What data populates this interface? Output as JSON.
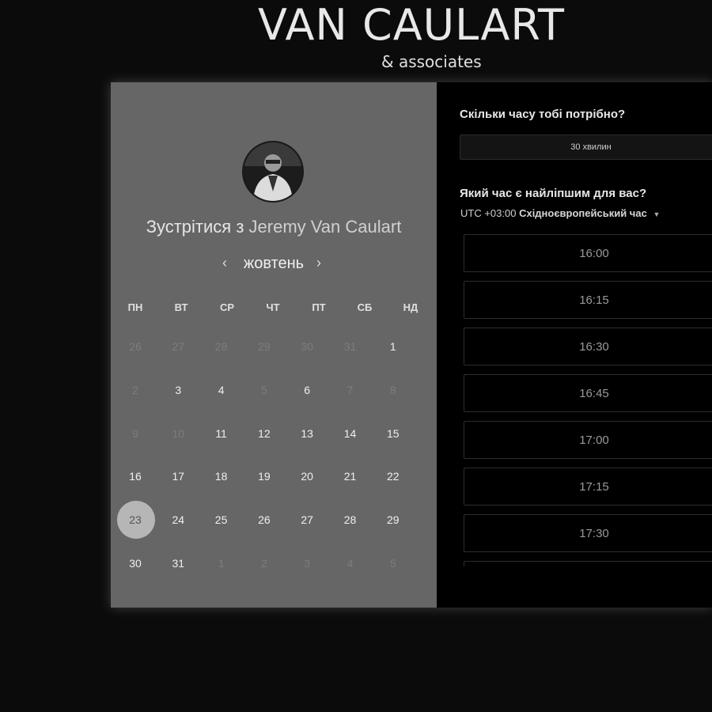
{
  "brand": {
    "name": "VAN CAULART",
    "sub": "& associates"
  },
  "left": {
    "meet_prefix": "Зустрітися з",
    "host": "Jeremy Van Caulart",
    "month": "жовтень",
    "prev_icon": "‹",
    "next_icon": "›",
    "weekdays": [
      "ПН",
      "ВТ",
      "СР",
      "ЧТ",
      "ПТ",
      "СБ",
      "НД"
    ],
    "days": [
      {
        "d": "26",
        "m": 1
      },
      {
        "d": "27",
        "m": 1
      },
      {
        "d": "28",
        "m": 1
      },
      {
        "d": "29",
        "m": 1
      },
      {
        "d": "30",
        "m": 1
      },
      {
        "d": "31",
        "m": 1
      },
      {
        "d": "1",
        "m": 0
      },
      {
        "d": "2",
        "m": 1
      },
      {
        "d": "3",
        "m": 0
      },
      {
        "d": "4",
        "m": 0
      },
      {
        "d": "5",
        "m": 1
      },
      {
        "d": "6",
        "m": 0
      },
      {
        "d": "7",
        "m": 1
      },
      {
        "d": "8",
        "m": 1
      },
      {
        "d": "9",
        "m": 1
      },
      {
        "d": "10",
        "m": 1
      },
      {
        "d": "11",
        "m": 0
      },
      {
        "d": "12",
        "m": 0
      },
      {
        "d": "13",
        "m": 0
      },
      {
        "d": "14",
        "m": 0
      },
      {
        "d": "15",
        "m": 0
      },
      {
        "d": "16",
        "m": 0
      },
      {
        "d": "17",
        "m": 0
      },
      {
        "d": "18",
        "m": 0
      },
      {
        "d": "19",
        "m": 0
      },
      {
        "d": "20",
        "m": 0
      },
      {
        "d": "21",
        "m": 0
      },
      {
        "d": "22",
        "m": 0
      },
      {
        "d": "23",
        "m": 0,
        "sel": 1
      },
      {
        "d": "24",
        "m": 0
      },
      {
        "d": "25",
        "m": 0
      },
      {
        "d": "26",
        "m": 0
      },
      {
        "d": "27",
        "m": 0
      },
      {
        "d": "28",
        "m": 0
      },
      {
        "d": "29",
        "m": 0
      },
      {
        "d": "30",
        "m": 0
      },
      {
        "d": "31",
        "m": 0
      },
      {
        "d": "1",
        "m": 1
      },
      {
        "d": "2",
        "m": 1
      },
      {
        "d": "3",
        "m": 1
      },
      {
        "d": "4",
        "m": 1
      },
      {
        "d": "5",
        "m": 1
      }
    ]
  },
  "right": {
    "duration_question": "Скільки часу тобі потрібно?",
    "duration_value": "30 хвилин",
    "time_question": "Який час є найліпшим для вас?",
    "tz_offset": "UTC +03:00",
    "tz_name": "Східноєвропейський час",
    "tz_caret": "▼",
    "slots": [
      "16:00",
      "16:15",
      "16:30",
      "16:45",
      "17:00",
      "17:15",
      "17:30",
      ""
    ]
  },
  "colors": {
    "left_panel": "#666666",
    "right_panel": "#000000",
    "selected_day": "#b6b6b6"
  }
}
